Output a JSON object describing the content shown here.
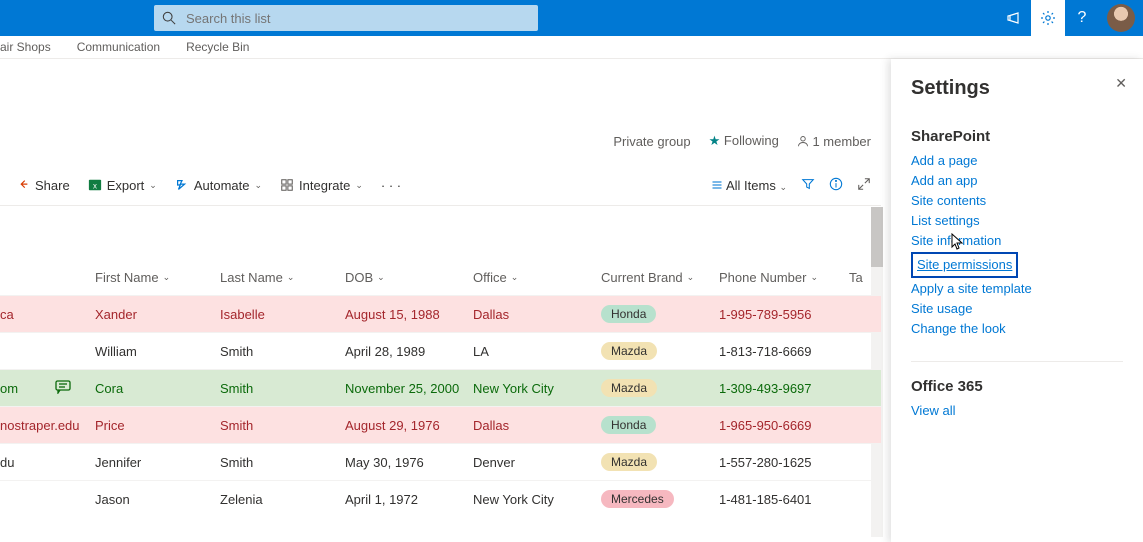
{
  "search": {
    "placeholder": "Search this list"
  },
  "nav": {
    "items": [
      "air Shops",
      "Communication",
      "Recycle Bin"
    ]
  },
  "status": {
    "group": "Private group",
    "following": "Following",
    "members": "1 member"
  },
  "toolbar": {
    "share": "Share",
    "export": "Export",
    "automate": "Automate",
    "integrate": "Integrate",
    "view": "All Items"
  },
  "columns": [
    "First Name",
    "Last Name",
    "DOB",
    "Office",
    "Current Brand",
    "Phone Number",
    "Ta"
  ],
  "rows": [
    {
      "c0": "ca",
      "icon": "",
      "first": "Xander",
      "last": "Isabelle",
      "dob": "August 15, 1988",
      "office": "Dallas",
      "brand": "Honda",
      "phone": "1-995-789-5956",
      "style": "red"
    },
    {
      "c0": "",
      "icon": "",
      "first": "William",
      "last": "Smith",
      "dob": "April 28, 1989",
      "office": "LA",
      "brand": "Mazda",
      "phone": "1-813-718-6669",
      "style": ""
    },
    {
      "c0": "om",
      "icon": "chat",
      "first": "Cora",
      "last": "Smith",
      "dob": "November 25, 2000",
      "office": "New York City",
      "brand": "Mazda",
      "phone": "1-309-493-9697",
      "style": "green"
    },
    {
      "c0": "nostraper.edu",
      "icon": "",
      "first": "Price",
      "last": "Smith",
      "dob": "August 29, 1976",
      "office": "Dallas",
      "brand": "Honda",
      "phone": "1-965-950-6669",
      "style": "red"
    },
    {
      "c0": "du",
      "icon": "",
      "first": "Jennifer",
      "last": "Smith",
      "dob": "May 30, 1976",
      "office": "Denver",
      "brand": "Mazda",
      "phone": "1-557-280-1625",
      "style": ""
    },
    {
      "c0": "",
      "icon": "",
      "first": "Jason",
      "last": "Zelenia",
      "dob": "April 1, 1972",
      "office": "New York City",
      "brand": "Mercedes",
      "phone": "1-481-185-6401",
      "style": ""
    }
  ],
  "panel": {
    "title": "Settings",
    "section1": "SharePoint",
    "links1": [
      "Add a page",
      "Add an app",
      "Site contents",
      "List settings",
      "Site information",
      "Site permissions",
      "Apply a site template",
      "Site usage",
      "Change the look"
    ],
    "highlight_index": 5,
    "section2": "Office 365",
    "links2": [
      "View all"
    ]
  }
}
